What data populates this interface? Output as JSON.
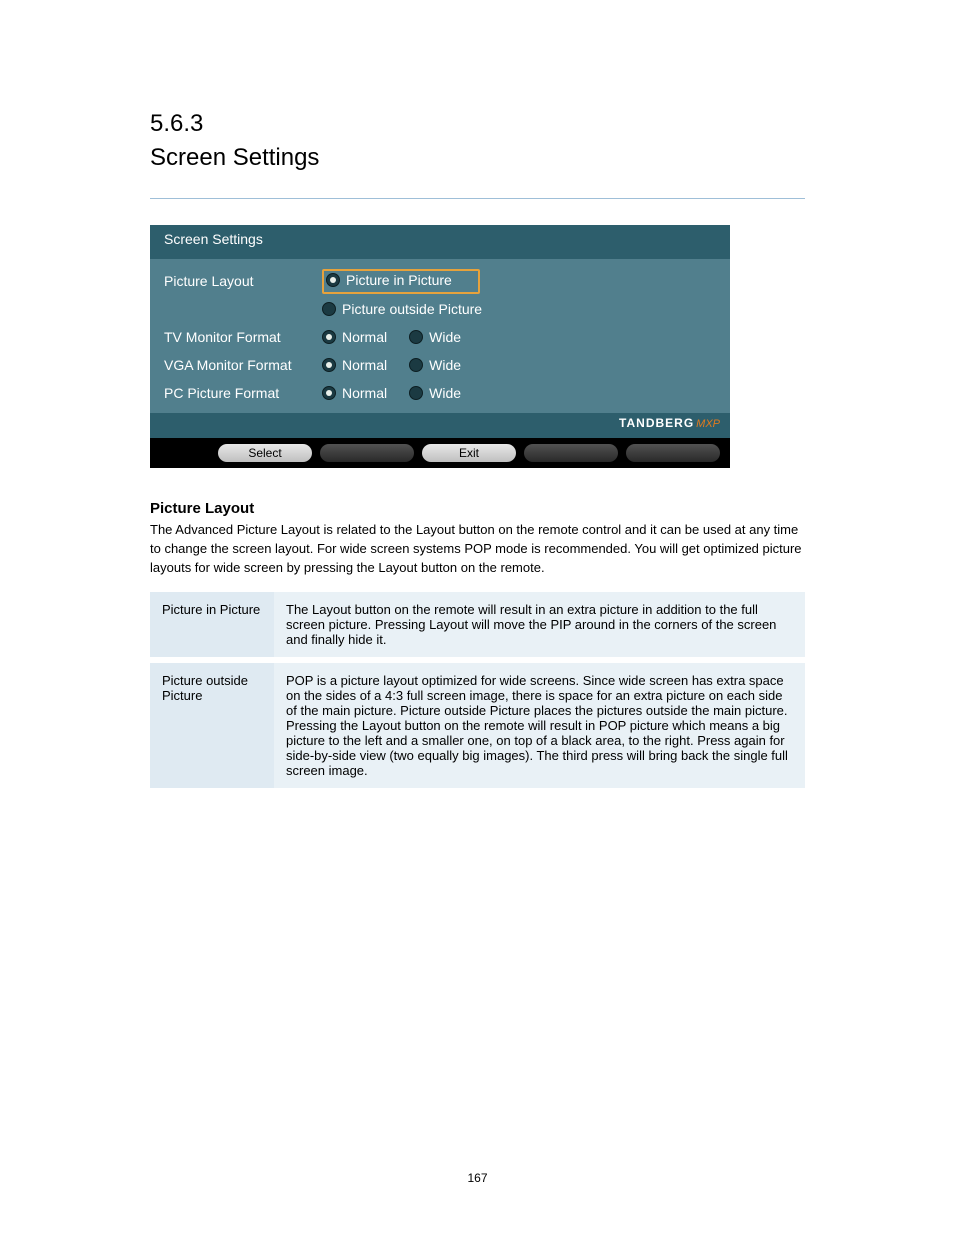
{
  "section": {
    "number": "5.6.3",
    "title": "Screen Settings"
  },
  "screenshot": {
    "header": "Screen Settings",
    "rows": [
      {
        "label": "Picture Layout",
        "options": [
          {
            "text": "Picture in Picture",
            "selected": true,
            "highlight": true
          },
          {
            "text": "Picture outside Picture",
            "selected": false
          }
        ],
        "stacked": true
      },
      {
        "label": "TV Monitor Format",
        "options": [
          {
            "text": "Normal",
            "selected": true
          },
          {
            "text": "Wide",
            "selected": false
          }
        ]
      },
      {
        "label": "VGA Monitor Format",
        "options": [
          {
            "text": "Normal",
            "selected": true
          },
          {
            "text": "Wide",
            "selected": false
          }
        ]
      },
      {
        "label": "PC Picture Format",
        "options": [
          {
            "text": "Normal",
            "selected": true
          },
          {
            "text": "Wide",
            "selected": false
          }
        ]
      }
    ],
    "brand": {
      "name": "TANDBERG",
      "suffix": "MXP"
    },
    "buttons": {
      "select": "Select",
      "exit": "Exit"
    }
  },
  "picture_layout": {
    "heading": "Picture Layout",
    "paragraph": "The Advanced Picture Layout is related to the Layout button on the remote control and it can be used at any time to change the screen layout. For wide screen systems POP mode is recommended. You will get optimized picture layouts for wide screen by pressing the Layout button on the remote."
  },
  "table": {
    "rows": [
      {
        "name": "Picture in Picture",
        "desc": "The Layout button on the remote will result in an extra picture in addition to the full screen picture. Pressing Layout will move the PIP around in the corners of the screen and finally hide it."
      },
      {
        "name": "Picture outside Picture",
        "desc": "POP is a picture layout optimized for wide screens. Since wide screen has extra space on the sides of a 4:3 full screen image, there is space for an extra picture on each side of the main picture. Picture outside Picture places the pictures outside the main picture. Pressing the Layout button on the remote will result in POP picture which means a big picture to the left and a smaller one, on top of a black area, to the right. Press again for side-by-side view (two equally big images). The third press will bring back the single full screen image."
      }
    ]
  },
  "footer": "167"
}
